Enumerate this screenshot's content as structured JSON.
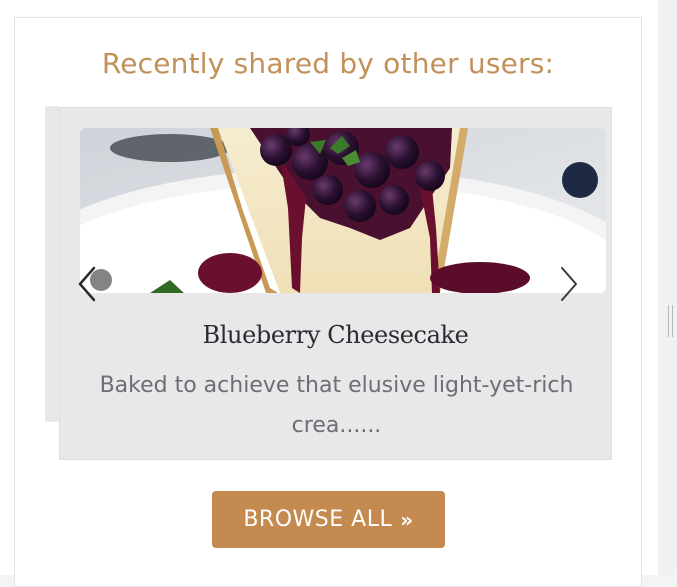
{
  "section": {
    "heading": "Recently shared by other users:"
  },
  "carousel": {
    "slide": {
      "title": "Blueberry Cheesecake",
      "description": "Baked to achieve that elusive light-yet-rich crea......",
      "image_icon": "cheesecake-photo"
    },
    "prev_icon": "chevron-left-icon",
    "next_icon": "chevron-right-icon"
  },
  "actions": {
    "browse_label": "BROWSE ALL",
    "browse_icon": "double-chevron-right-icon"
  },
  "colors": {
    "accent": "#c2915a",
    "button": "#c48a4f",
    "slide_bg": "#e8e8e8"
  }
}
